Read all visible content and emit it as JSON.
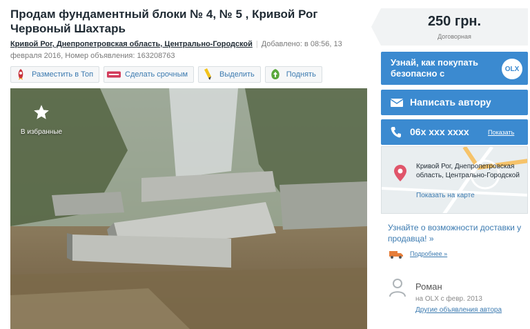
{
  "listing": {
    "title": "Продам фундаментный блоки № 4, № 5 , Кривой Рог Червоный Шахтарь",
    "location": "Кривой Рог, Днепропетровская область, Центрально-Городской",
    "added": "Добавлено: в 08:56, 13 февраля 2016, Номер объявления: 163208763"
  },
  "actions": [
    {
      "label": "Разместить в Топ",
      "icon": "rocket-icon"
    },
    {
      "label": "Сделать срочным",
      "icon": "urgent-tag-icon"
    },
    {
      "label": "Выделить",
      "icon": "highlighter-icon"
    },
    {
      "label": "Поднять",
      "icon": "up-arrow-icon"
    }
  ],
  "photo": {
    "favorite_label": "В избранные",
    "favorite_icon": "star-icon"
  },
  "price": {
    "amount": "250 грн.",
    "negotiable": "Договорная"
  },
  "buttons": {
    "safe_buy": "Узнай, как покупать безопасно с",
    "olx": "OLX",
    "message": "Написать автору",
    "phone": "06x xxx xxxx",
    "phone_show": "Показать"
  },
  "map": {
    "address": "Кривой Рог, Днепропетровская область, Центрально-Городской",
    "show_on_map": "Показать на карте"
  },
  "delivery": {
    "text": "Узнайте о возможности доставки у продавца! »",
    "more": "Подробнее »"
  },
  "seller": {
    "name": "Роман",
    "since": "на OLX с февр. 2013",
    "other_ads": "Другие объявления автора"
  },
  "colors": {
    "accent": "#3b8ad0",
    "link": "#3b7ab0",
    "price_bg": "#f1f3f4"
  }
}
